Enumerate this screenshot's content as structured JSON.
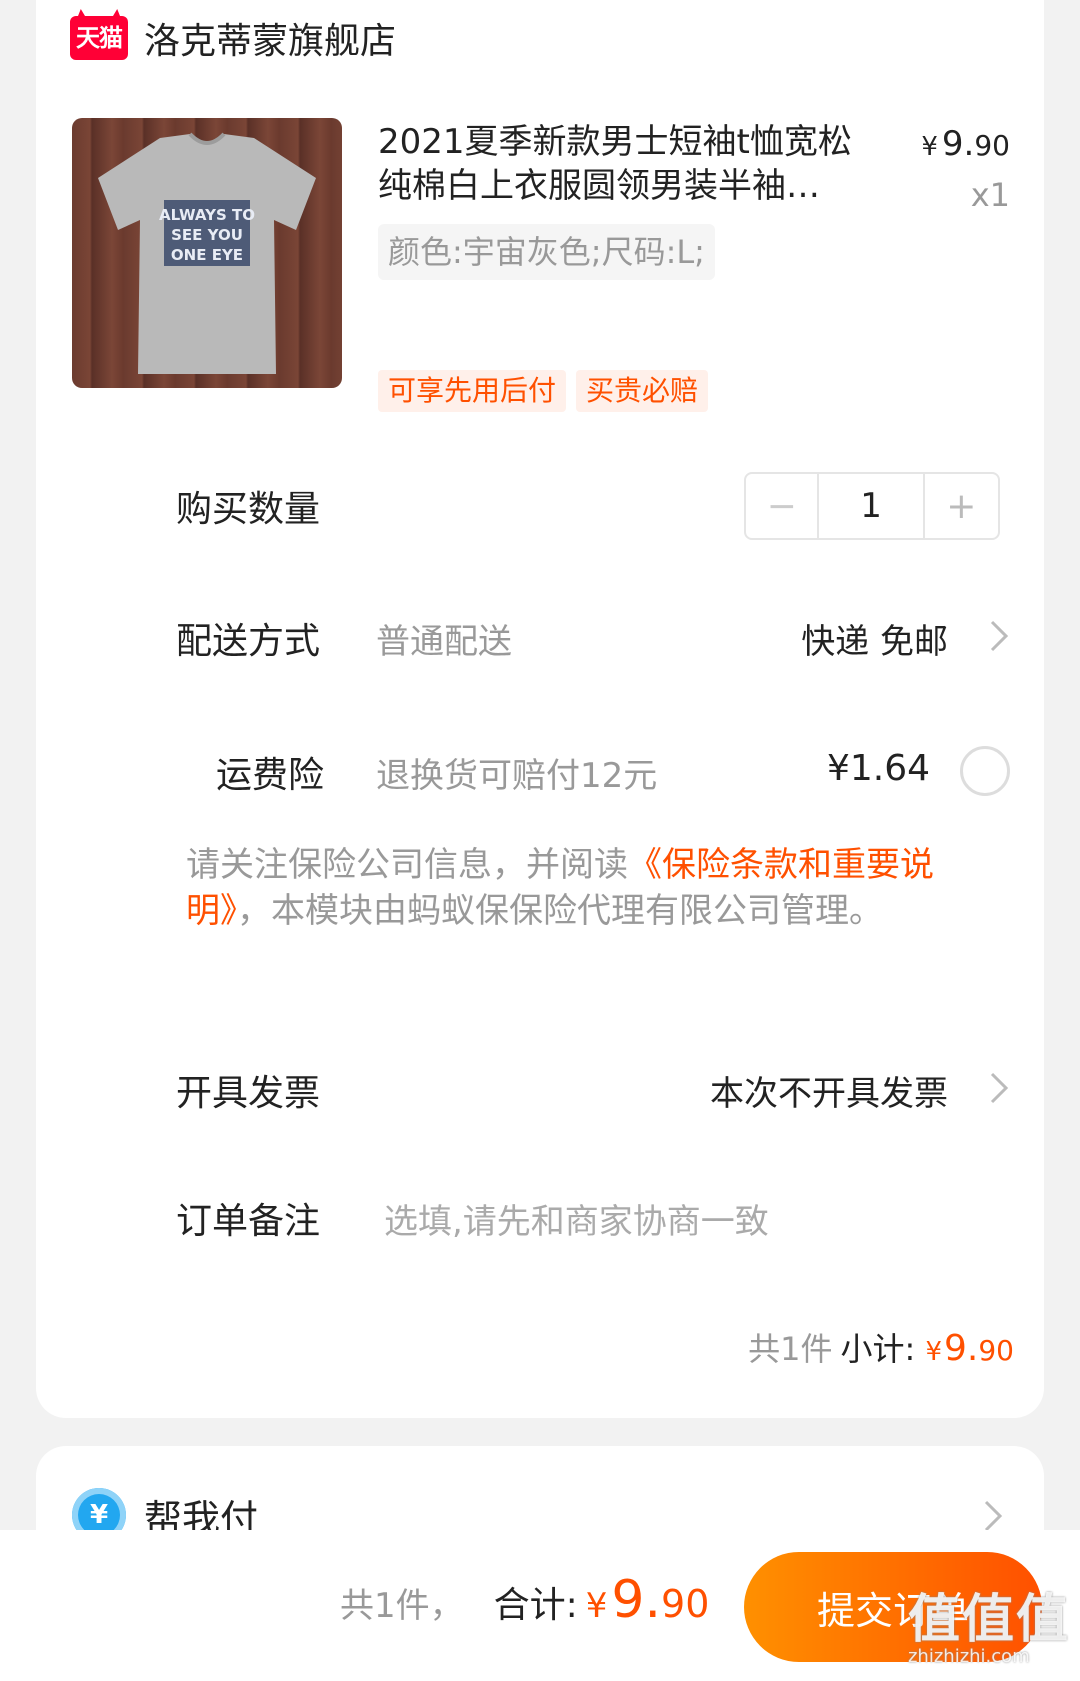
{
  "shop": {
    "logo_text": "天猫",
    "name": "洛克蒂蒙旗舰店"
  },
  "product": {
    "image_icon": "tshirt-image",
    "image_text": "ALWAYS TO SEE YOU ONE EYE",
    "title": "2021夏季新款男士短袖t恤宽松纯棉白上衣服圆领男装半袖…",
    "price_symbol": "¥",
    "price_int": "9.",
    "price_dec": "90",
    "quantity_label": "x1",
    "sku": "颜色:宇宙灰色;尺码:L;",
    "tags": [
      "可享先用后付",
      "买贵必赔"
    ]
  },
  "purchase_qty": {
    "label": "购买数量",
    "minus": "−",
    "value": "1",
    "plus": "+"
  },
  "delivery": {
    "label": "配送方式",
    "sub": "普通配送",
    "value": "快递 免邮"
  },
  "freight_insurance": {
    "label": "运费险",
    "sub": "退换货可赔付12元",
    "price": "¥1.64"
  },
  "notice": {
    "prefix": "请关注保险公司信息，并阅读",
    "link": "《保险条款和重要说明》",
    "suffix": "，本模块由蚂蚁保保险代理有限公司管理。"
  },
  "invoice": {
    "label": "开具发票",
    "value": "本次不开具发票"
  },
  "remark": {
    "label": "订单备注",
    "placeholder": "选填,请先和商家协商一致"
  },
  "subtotal": {
    "count": "共1件",
    "label": "小计:",
    "symbol": "¥",
    "int": "9.",
    "dec": "90"
  },
  "help_pay": {
    "icon_text": "¥",
    "label": "帮我付"
  },
  "bottom": {
    "count": "共1件，",
    "label": "合计:",
    "symbol": "¥",
    "int": "9.",
    "dec": "90",
    "submit": "提交订单"
  },
  "watermark": {
    "big": "值值值",
    "small": "zhizhizhi.com"
  },
  "colors": {
    "accent": "#ff5000",
    "tmall": "#ff0036",
    "muted": "#999999",
    "helppay": "#22a7f0"
  }
}
